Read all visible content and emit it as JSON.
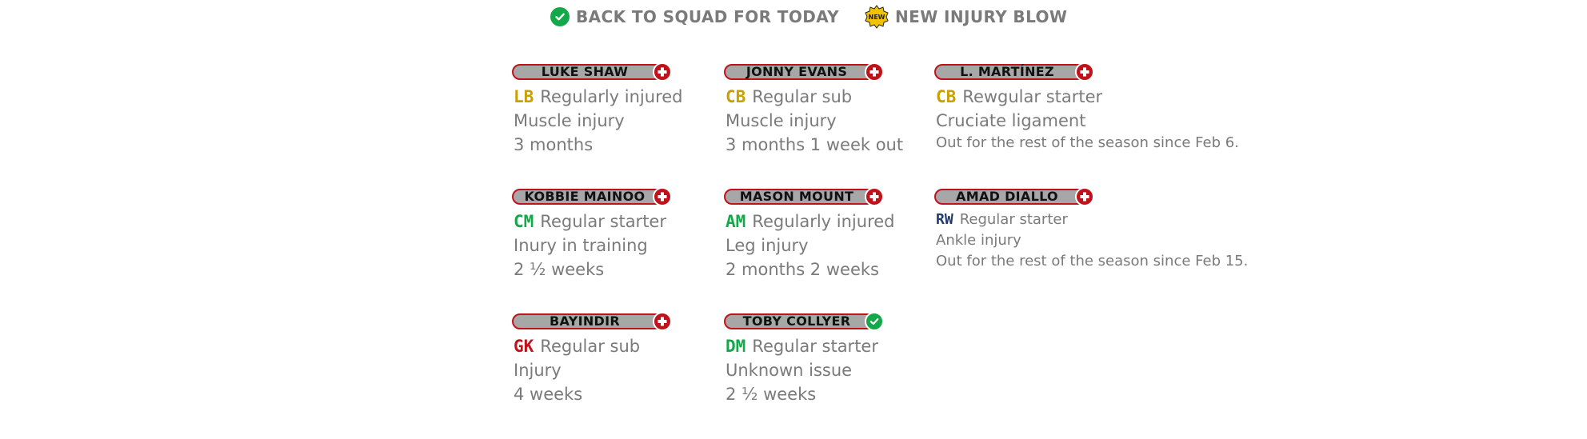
{
  "legend": {
    "back_label": "BACK TO SQUAD FOR TODAY",
    "new_label": "NEW INJURY BLOW",
    "new_badge_text": "NEW",
    "colors": {
      "back_green": "#14a84a",
      "new_gold": "#f2c200"
    }
  },
  "players": [
    {
      "name": "LUKE SHAW",
      "status": "injured",
      "status_icon": "plus-icon",
      "position": "LB",
      "position_color": "#c8a000",
      "role": "Regularly injured",
      "injury": "Muscle injury",
      "duration": "3 months"
    },
    {
      "name": "JONNY EVANS",
      "status": "injured",
      "status_icon": "plus-icon",
      "position": "CB",
      "position_color": "#c8a000",
      "role": "Regular sub",
      "injury": "Muscle injury",
      "duration": "3 months 1 week out"
    },
    {
      "name": "L. MARTÍNEZ",
      "status": "injured",
      "status_icon": "plus-icon",
      "position": "CB",
      "position_color": "#c8a000",
      "role": "Rewgular starter",
      "injury": "Cruciate ligament",
      "duration": "Out for the rest of the season since Feb 6."
    },
    {
      "name": "KOBBIE MAINOO",
      "status": "injured",
      "status_icon": "plus-icon",
      "position": "CM",
      "position_color": "#14a84a",
      "role": "Regular starter",
      "injury": "Inury in training",
      "duration": "2 ½ weeks"
    },
    {
      "name": "MASON MOUNT",
      "status": "injured",
      "status_icon": "plus-icon",
      "position": "AM",
      "position_color": "#14a84a",
      "role": "Regularly injured",
      "injury": "Leg injury",
      "duration": "2 months 2 weeks"
    },
    {
      "name": "AMAD DIALLO",
      "status": "injured",
      "status_icon": "plus-icon",
      "position": "RW",
      "position_color": "#1f3b73",
      "role": "Regular starter",
      "injury": "Ankle injury",
      "duration": "Out for the rest of the season since Feb 15."
    },
    {
      "name": "BAYINDIR",
      "status": "injured",
      "status_icon": "plus-icon",
      "position": "GK",
      "position_color": "#c0121b",
      "role": "Regular sub",
      "injury": "Injury",
      "duration": "4 weeks"
    },
    {
      "name": "TOBY COLLYER",
      "status": "back",
      "status_icon": "check-icon",
      "position": "DM",
      "position_color": "#14a84a",
      "role": "Regular starter",
      "injury": "Unknown issue",
      "duration": "2 ½ weeks"
    }
  ]
}
